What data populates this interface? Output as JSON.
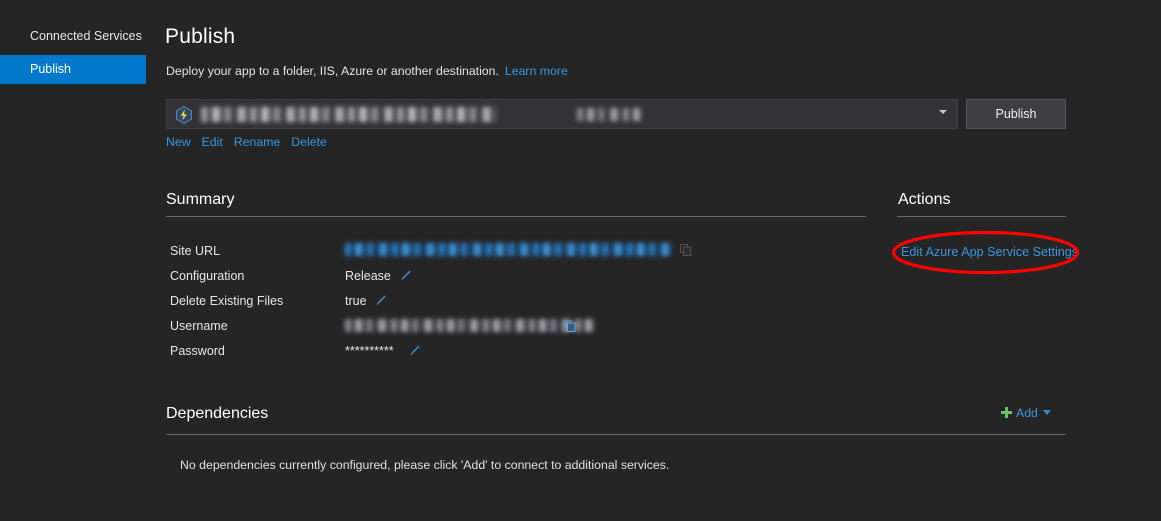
{
  "sidebar": {
    "items": [
      {
        "label": "Connected Services",
        "selected": false
      },
      {
        "label": "Publish",
        "selected": true
      }
    ]
  },
  "header": {
    "title": "Publish",
    "subtitle": "Deploy your app to a folder, IIS, Azure or another destination.",
    "learn_more_label": "Learn more"
  },
  "profile": {
    "icon_name": "azure-app-service-icon",
    "value_redacted": "███████████████",
    "value_secondary_redacted": "█████",
    "dropdown_icon": "chevron-down-icon",
    "publish_button_label": "Publish",
    "links": [
      "New",
      "Edit",
      "Rename",
      "Delete"
    ]
  },
  "summary": {
    "title": "Summary",
    "rows": [
      {
        "label": "Site URL",
        "value": "",
        "redacted": true,
        "copy": true,
        "edit": false
      },
      {
        "label": "Configuration",
        "value": "Release",
        "redacted": false,
        "copy": false,
        "edit": true
      },
      {
        "label": "Delete Existing Files",
        "value": "true",
        "redacted": false,
        "copy": false,
        "edit": true
      },
      {
        "label": "Username",
        "value": "",
        "redacted": true,
        "copy": true,
        "edit": false
      },
      {
        "label": "Password",
        "value": "**********",
        "redacted": false,
        "copy": false,
        "edit": true
      }
    ]
  },
  "actions": {
    "title": "Actions",
    "link_label": "Edit Azure App Service Settings",
    "annotation": {
      "shape": "ellipse",
      "color": "#ff0000"
    }
  },
  "dependencies": {
    "title": "Dependencies",
    "add_label": "Add",
    "add_icon": "plus-icon",
    "add_caret_icon": "caret-down-icon",
    "empty_message": "No dependencies currently configured, please click 'Add' to connect to additional services."
  },
  "colors": {
    "background": "#252526",
    "accent_blue": "#0079cc",
    "link_blue": "#3a96dd",
    "plus_green": "#67c267",
    "annotation_red": "#ff0000"
  }
}
